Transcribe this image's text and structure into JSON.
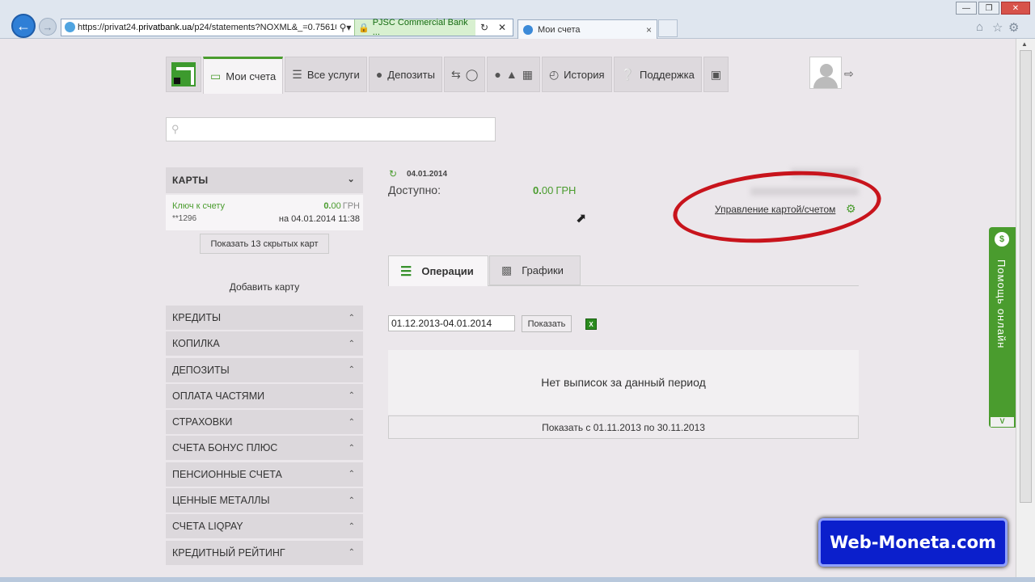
{
  "browser": {
    "url_prefix": "https://privat24.",
    "url_domain": "privatbank.ua",
    "url_path": "/p24/statements?NOXML&_=0.7561018",
    "cert_label": "PJSC Commercial Bank ...",
    "tab_title": "Мои счета",
    "tab_close": "×"
  },
  "nav": {
    "my_accounts": "Мои счета",
    "all_services": "Все услуги",
    "deposits": "Депозиты",
    "history": "История",
    "support": "Поддержка"
  },
  "search": {
    "placeholder": ""
  },
  "sidebar": {
    "cards_header": "КАРТЫ",
    "card": {
      "name": "Ключ к счету",
      "number": "**1296",
      "balance_int": "0.",
      "balance_dec": "00",
      "currency": "ГРН",
      "date": "на 04.01.2014 11:38"
    },
    "show_hidden": "Показать 13 скрытых карт",
    "add_card": "Добавить карту",
    "items": [
      {
        "label": "КРЕДИТЫ"
      },
      {
        "label": "КОПИЛКА"
      },
      {
        "label": "ДЕПОЗИТЫ"
      },
      {
        "label": "ОПЛАТА ЧАСТЯМИ"
      },
      {
        "label": "СТРАХОВКИ"
      },
      {
        "label": "СЧЕТА БОНУС ПЛЮС"
      },
      {
        "label": "ПЕНСИОННЫЕ СЧЕТА"
      },
      {
        "label": "ЦЕННЫЕ МЕТАЛЛЫ"
      },
      {
        "label": "СЧЕТА LIQPAY"
      },
      {
        "label": "КРЕДИТНЫЙ РЕЙТИНГ"
      }
    ]
  },
  "account": {
    "date": "04.01.2014",
    "available_label": "Доступно:",
    "available_int": "0.",
    "available_dec": "00",
    "currency": "ГРН",
    "manage_link": "Управление картой/счетом"
  },
  "tabs": {
    "operations": "Операции",
    "charts": "Графики"
  },
  "filter": {
    "period": "01.12.2013-04.01.2014",
    "show_button": "Показать"
  },
  "results": {
    "empty_text": "Нет выписок за данный период",
    "show_prev": "Показать с 01.11.2013 по 30.11.2013"
  },
  "help": {
    "label": "Помощь онлайн",
    "icon": "$",
    "arrow": "V"
  },
  "watermark": "Web-Moneta.com"
}
